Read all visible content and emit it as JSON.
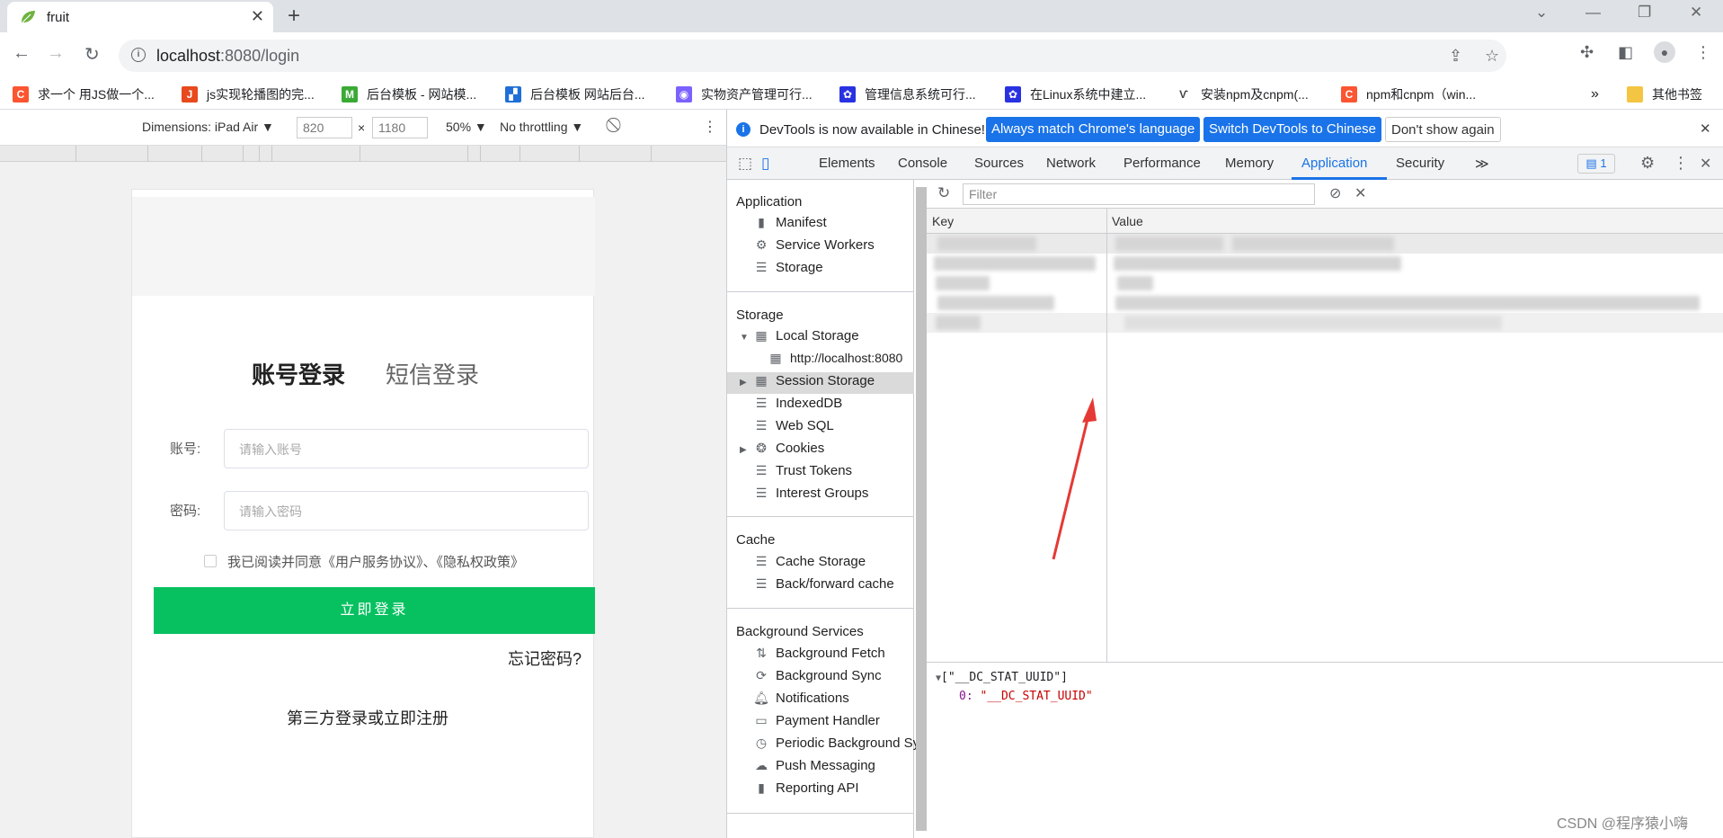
{
  "browser": {
    "tab_title": "fruit",
    "url_host": "localhost",
    "url_rest": ":8080/login",
    "bookmarks": [
      {
        "label": "求一个 用JS做一个...",
        "icon": "csdn-icon",
        "color": "#fc5531",
        "glyph": "C"
      },
      {
        "label": "js实现轮播图的完...",
        "icon": "js-icon",
        "color": "#e8491d",
        "glyph": "J"
      },
      {
        "label": "后台模板 - 网站模...",
        "icon": "m-icon",
        "color": "#3aaa35",
        "glyph": "M"
      },
      {
        "label": "后台模板 网站后台...",
        "icon": "template-icon",
        "color": "#1f6fd6",
        "glyph": "▞"
      },
      {
        "label": "实物资产管理可行...",
        "icon": "avatar-icon",
        "color": "#7b61ff",
        "glyph": "◉"
      },
      {
        "label": "管理信息系统可行...",
        "icon": "baidu-icon",
        "color": "#2932e1",
        "glyph": "✿"
      },
      {
        "label": "在Linux系统中建立...",
        "icon": "baidu-icon",
        "color": "#2932e1",
        "glyph": "✿"
      },
      {
        "label": "安装npm及cnpm(...",
        "icon": "bookmark-icon",
        "color": "#444444",
        "glyph": "Ѵ"
      },
      {
        "label": "npm和cnpm（win...",
        "icon": "csdn-icon",
        "color": "#fc5531",
        "glyph": "C"
      }
    ],
    "bookmarks_more": "»",
    "other_bookmarks": "其他书签"
  },
  "device_toolbar": {
    "dimensions_label": "Dimensions: iPad Air ▼",
    "width": "820",
    "height": "1180",
    "times": "×",
    "zoom": "50% ▼",
    "throttling": "No throttling ▼"
  },
  "login_page": {
    "tab_account": "账号登录",
    "tab_sms": "短信登录",
    "account_label": "账号:",
    "account_placeholder": "请输入账号",
    "password_label": "密码:",
    "password_placeholder": "请输入密码",
    "agree_text": "我已阅读并同意《用户服务协议》、《隐私权政策》",
    "login_button": "立即登录",
    "forgot": "忘记密码?",
    "third_party": "第三方登录或立即注册"
  },
  "devtools": {
    "info_message": "DevTools is now available in Chinese!",
    "btn_match": "Always match Chrome's language",
    "btn_switch": "Switch DevTools to Chinese",
    "btn_dont_show": "Don't show again",
    "tabs": [
      "Elements",
      "Console",
      "Sources",
      "Network",
      "Performance",
      "Memory",
      "Application",
      "Security"
    ],
    "active_tab": "Application",
    "issues_count": "1",
    "sidebar": {
      "application_title": "Application",
      "application_items": [
        "Manifest",
        "Service Workers",
        "Storage"
      ],
      "storage_title": "Storage",
      "local_storage": "Local Storage",
      "local_storage_origin": "http://localhost:8080",
      "storage_items": [
        "Session Storage",
        "IndexedDB",
        "Web SQL",
        "Cookies",
        "Trust Tokens",
        "Interest Groups"
      ],
      "cache_title": "Cache",
      "cache_items": [
        "Cache Storage",
        "Back/forward cache"
      ],
      "background_title": "Background Services",
      "background_items": [
        "Background Fetch",
        "Background Sync",
        "Notifications",
        "Payment Handler",
        "Periodic Background Sy",
        "Push Messaging",
        "Reporting API"
      ]
    },
    "filter_placeholder": "Filter",
    "table_key": "Key",
    "table_value": "Value",
    "preview_line1": "[\"__DC_STAT_UUID\"]",
    "preview_index": "0:",
    "preview_value": "\"__DC_STAT_UUID\""
  },
  "watermark": "CSDN @程序猿小嗨",
  "colors": {
    "accent": "#1a73e8",
    "login_green": "#07c160",
    "annotation_arrow": "#e53935"
  }
}
